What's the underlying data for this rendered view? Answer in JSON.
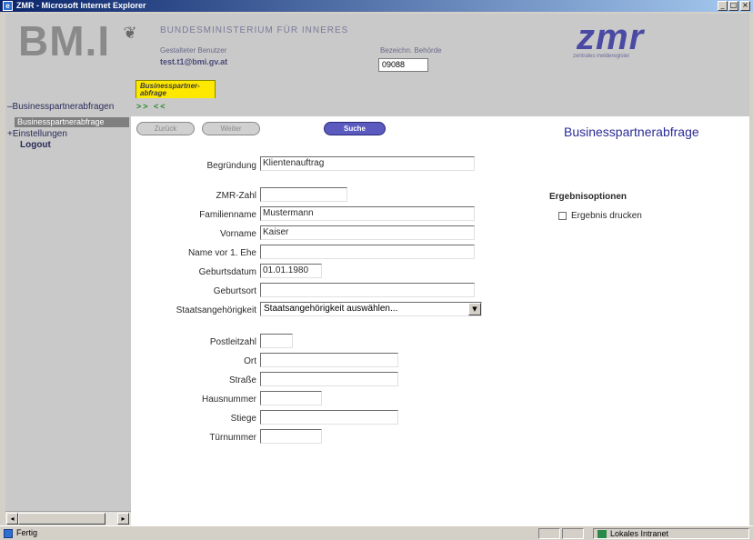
{
  "window": {
    "title": "ZMR - Microsoft Internet Explorer",
    "minimize_glyph": "_",
    "maximize_glyph": "□",
    "close_glyph": "×"
  },
  "header": {
    "logo_text": "BM.I",
    "ministry_name": "BUNDESMINISTERIUM FÜR INNERES",
    "user_label": "Gestalteter Benutzer",
    "user_email": "test.t1@bmi.gv.at",
    "behoerde_label": "Bezeichn. Behörde",
    "behoerde_value": "09088",
    "zmr_logo": "zmr",
    "zmr_subtitle": "zentrales melderegister",
    "tab_label": "Businesspartner-abfrage"
  },
  "nav": {
    "items": [
      {
        "label": "–Businesspartnerabfragen"
      },
      {
        "label": "Businesspartnerabfrage"
      },
      {
        "label": "+Einstellungen"
      },
      {
        "label": "Logout"
      }
    ]
  },
  "subbar": {
    "arrows": ">> <<"
  },
  "buttons": {
    "back": "Zurück",
    "next": "Weiter",
    "search": "Suche"
  },
  "page_title": "Businesspartnerabfrage",
  "form": {
    "begruendung": {
      "label": "Begründung",
      "value": "Klientenauftrag"
    },
    "zmr_zahl": {
      "label": "ZMR-Zahl",
      "value": ""
    },
    "familienname": {
      "label": "Familienname",
      "value": "Mustermann"
    },
    "vorname": {
      "label": "Vorname",
      "value": "Kaiser"
    },
    "name_vor_ehe": {
      "label": "Name vor 1. Ehe",
      "value": ""
    },
    "geburtsdatum": {
      "label": "Geburtsdatum",
      "value": "01.01.1980"
    },
    "geburtsort": {
      "label": "Geburtsort",
      "value": ""
    },
    "staatsangehoerigkeit": {
      "label": "Staatsangehörigkeit",
      "value": "Staatsangehörigkeit auswählen..."
    },
    "postleitzahl": {
      "label": "Postleitzahl",
      "value": ""
    },
    "ort": {
      "label": "Ort",
      "value": ""
    },
    "strasse": {
      "label": "Straße",
      "value": ""
    },
    "hausnummer": {
      "label": "Hausnummer",
      "value": ""
    },
    "stiege": {
      "label": "Stiege",
      "value": ""
    },
    "tuernummer": {
      "label": "Türnummer",
      "value": ""
    }
  },
  "options": {
    "title": "Ergebnisoptionen",
    "print_label": "Ergebnis drucken"
  },
  "statusbar": {
    "status_text": "Fertig",
    "zone_text": "Lokales Intranet"
  },
  "colors": {
    "title_gradient_start": "#0a246a",
    "header_bg": "#c9c9c9",
    "search_button": "#5a5abf",
    "page_title": "#2b2b9a",
    "tab_yellow": "#ffe800"
  }
}
